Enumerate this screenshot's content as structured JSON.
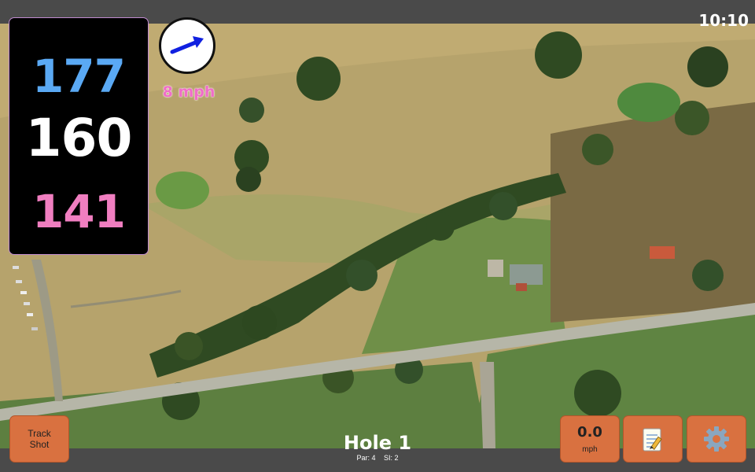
{
  "status": {
    "time": "10:10"
  },
  "distances": {
    "back": "177",
    "middle": "160",
    "front": "141"
  },
  "wind": {
    "speed_label": "8 mph",
    "direction_icon": "arrow-east-northeast-icon",
    "arrow_color": "#1020e0"
  },
  "hole": {
    "title": "Hole 1",
    "par_label": "Par: 4",
    "si_label": "SI: 2"
  },
  "buttons": {
    "track_line1": "Track",
    "track_line2": "Shot",
    "windmeter_value": "0.0",
    "windmeter_unit": "mph",
    "notes_icon": "notepad-icon",
    "settings_icon": "gear-icon"
  },
  "colors": {
    "button": "#d97140",
    "back_distance": "#5aa9f4",
    "middle_distance": "#ffffff",
    "front_distance": "#f07ec0",
    "wind_label": "#f06dc8"
  }
}
